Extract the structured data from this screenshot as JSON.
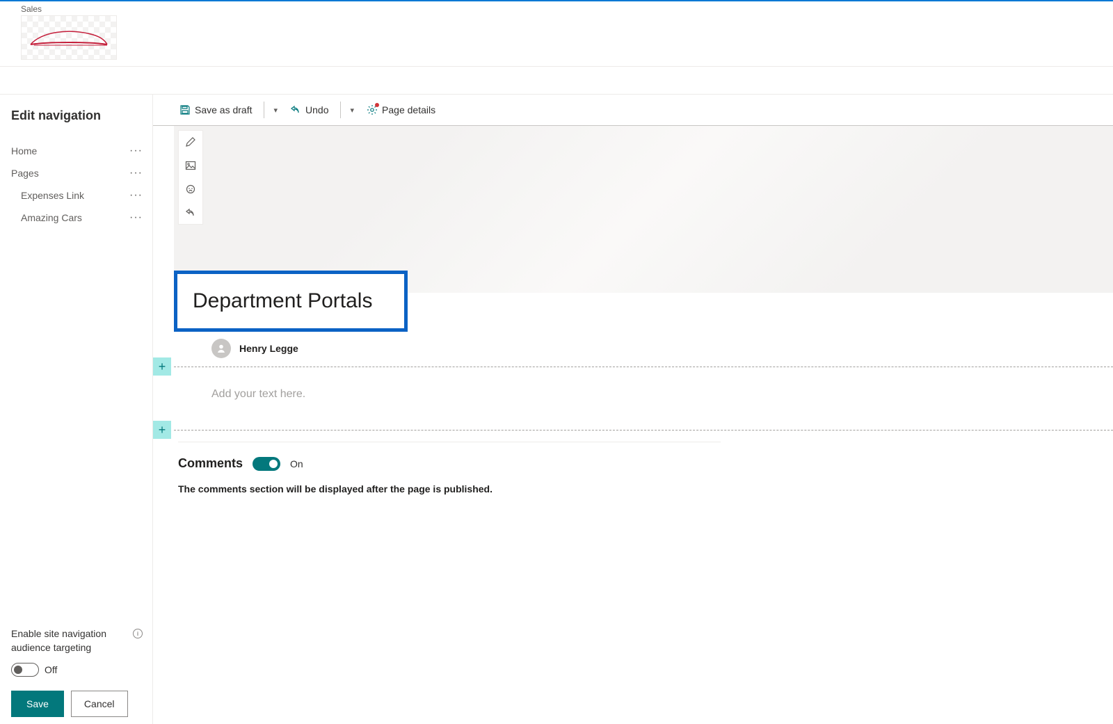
{
  "header": {
    "site_name": "Sales"
  },
  "sidebar": {
    "title": "Edit navigation",
    "items": [
      {
        "label": "Home",
        "child": false
      },
      {
        "label": "Pages",
        "child": false
      },
      {
        "label": "Expenses Link",
        "child": true
      },
      {
        "label": "Amazing Cars",
        "child": true
      }
    ],
    "targeting_label": "Enable site navigation audience targeting",
    "targeting_toggle_label": "Off",
    "save_label": "Save",
    "cancel_label": "Cancel"
  },
  "commandbar": {
    "save_draft": "Save as draft",
    "undo": "Undo",
    "page_details": "Page details"
  },
  "page": {
    "title": "Department Portals",
    "author": "Henry Legge",
    "text_placeholder": "Add your text here."
  },
  "comments": {
    "title": "Comments",
    "toggle_label": "On",
    "note": "The comments section will be displayed after the page is published."
  }
}
